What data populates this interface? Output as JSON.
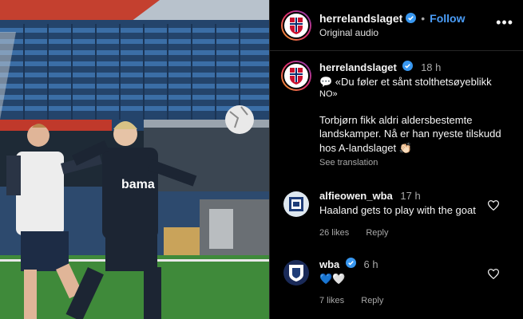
{
  "post": {
    "username": "herrelandslaget",
    "follow_label": "Follow",
    "audio_label": "Original audio",
    "more_label": "•••"
  },
  "caption": {
    "username": "herrelandslaget",
    "time": "18 h",
    "line1": "💬 «Du føler et sånt stolthetsøyeblikk",
    "line2": "NO»",
    "line3": "Torbjørn fikk aldri aldersbestemte",
    "line4": "landskamper. Nå er han nyeste tilskudd",
    "line5": "hos A-landslaget 👏🏻",
    "see_translation": "See translation"
  },
  "comments": [
    {
      "username": "alfieowen_wba",
      "time": "17 h",
      "text": "Haaland gets to play with the goat",
      "likes": "26 likes",
      "reply": "Reply",
      "verified": false
    },
    {
      "username": "wba",
      "time": "6 h",
      "text": "💙🤍",
      "likes": "7 likes",
      "reply": "Reply",
      "verified": true
    }
  ],
  "media": {
    "jersey_text": "bama"
  },
  "colors": {
    "accent": "#4a9df8",
    "verified": "#3897f0",
    "stands": "#2d5a8c",
    "pitch": "#3f8a3a"
  }
}
